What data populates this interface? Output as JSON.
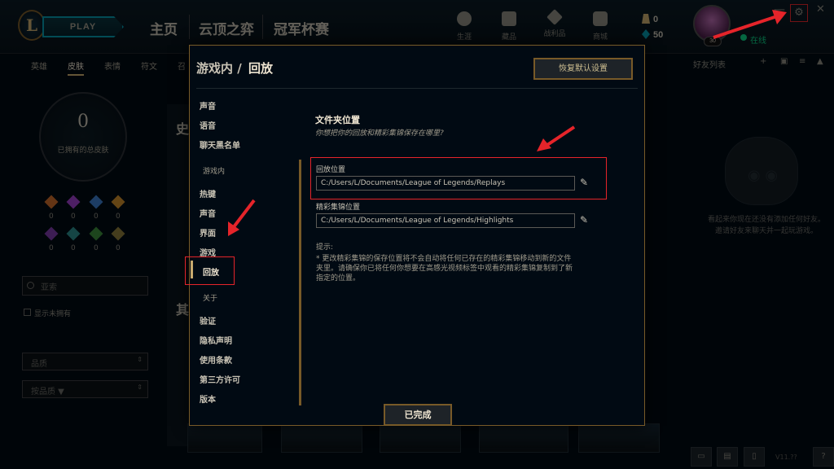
{
  "app": {
    "logo": "L",
    "play_label": "PLAY",
    "nav_tabs": [
      "主页",
      "云顶之弈",
      "冠军杯赛"
    ],
    "top_icons": [
      {
        "label": "生涯",
        "icon": "profile-icon"
      },
      {
        "label": "藏品",
        "icon": "collection-icon"
      },
      {
        "label": "战利品",
        "icon": "loot-icon"
      },
      {
        "label": "商城",
        "icon": "store-icon"
      }
    ],
    "currency": {
      "be": "0",
      "rp": "50"
    },
    "level": "30",
    "status": "在线",
    "window_controls": {
      "minimize": "—",
      "settings": "⚙",
      "close": "✕"
    }
  },
  "subnav": {
    "tabs": [
      "英雄",
      "皮肤",
      "表情",
      "符文",
      "召"
    ],
    "active": "皮肤"
  },
  "collection": {
    "owned_count": "0",
    "owned_label": "已拥有的总皮肤",
    "gem_values": [
      "0",
      "0",
      "0",
      "0",
      "0",
      "0",
      "0",
      "0"
    ],
    "search_placeholder": "亚索",
    "show_unowned": "显示未拥有",
    "filter1": "品质",
    "filter2": "按品质 ▼",
    "bg_title1": "史",
    "bg_title2": "其"
  },
  "friends": {
    "title": "好友列表",
    "empty_text": "看起来你现在还没有添加任何好友。邀请好友来聊天并一起玩游戏。",
    "version": "V11.??"
  },
  "settings": {
    "breadcrumb_parent": "游戏内",
    "breadcrumb_sep": "/",
    "breadcrumb_current": "回放",
    "restore_label": "恢复默认设置",
    "nav_client": [
      "声音",
      "语音",
      "聊天黑名单"
    ],
    "nav_ingame_header": "游戏内",
    "nav_ingame": [
      "热键",
      "声音",
      "界面",
      "游戏",
      "回放"
    ],
    "nav_about_header": "关于",
    "nav_about": [
      "验证",
      "隐私声明",
      "使用条款",
      "第三方许可",
      "版本"
    ],
    "section_title": "文件夹位置",
    "section_subtitle": "你想把你的回放和精彩集锦保存在哪里?",
    "replay_label": "回放位置",
    "replay_path": "C:/Users/L/Documents/League of Legends/Replays",
    "highlight_label": "精彩集锦位置",
    "highlight_path": "C:/Users/L/Documents/League of Legends/Highlights",
    "tip_title": "提示:",
    "tip_body": "* 更改精彩集锦的保存位置将不会自动将任何已存在的精彩集锦移动到新的文件夹里。请确保你已将任何你想要在高感光视频标签中观看的精彩集锦复制到了新指定的位置。",
    "done_label": "已完成"
  },
  "colors": {
    "gold": "#c8aa6e",
    "annotation_red": "#e5242a",
    "online_green": "#0acf83",
    "bg": "#010a13"
  }
}
